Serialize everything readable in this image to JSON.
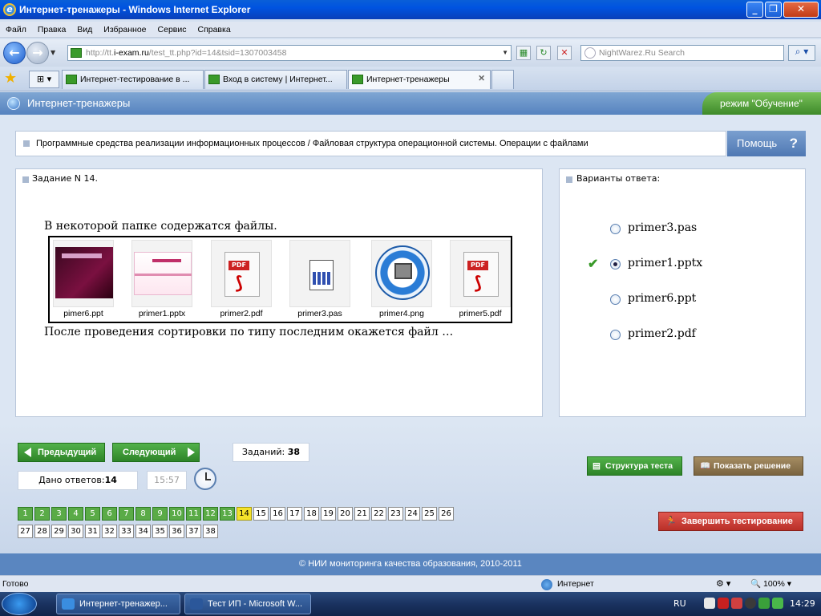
{
  "window": {
    "title": "Интернет-тренажеры - Windows Internet Explorer"
  },
  "menu": [
    "Файл",
    "Правка",
    "Вид",
    "Избранное",
    "Сервис",
    "Справка"
  ],
  "address": {
    "prefix": "http://tt.",
    "domain": "i-exam.ru",
    "path": "/test_tt.php?id=14&tsid=1307003458"
  },
  "search": {
    "placeholder": "NightWarez.Ru Search"
  },
  "tabs": [
    {
      "label": "Интернет-тестирование в ..."
    },
    {
      "label": "Вход в систему | Интернет..."
    },
    {
      "label": "Интернет-тренажеры",
      "active": true
    }
  ],
  "app": {
    "name": "Интернет-тренажеры",
    "mode": "режим \"Обучение\""
  },
  "breadcrumb": "Программные средства реализации информационных процессов / Файловая структура операционной системы. Операции с файлами",
  "help": {
    "label": "Помощь",
    "icon": "?"
  },
  "task": {
    "header": "Задание N 14.",
    "text_before": "В некоторой папке содержатся файлы.",
    "text_after": "После проведения сортировки по типу последним окажется файл …",
    "files": [
      "pimer6.ppt",
      "primer1.pptx",
      "primer2.pdf",
      "primer3.pas",
      "primer4.png",
      "primer5.pdf"
    ]
  },
  "answers": {
    "header": "Варианты ответа:",
    "options": [
      {
        "label": "primer3.pas",
        "selected": false,
        "correct": false
      },
      {
        "label": "primer1.pptx",
        "selected": true,
        "correct": true
      },
      {
        "label": "primer6.ppt",
        "selected": false,
        "correct": false
      },
      {
        "label": "primer2.pdf",
        "selected": false,
        "correct": false
      }
    ]
  },
  "nav": {
    "prev": "Предыдущий",
    "next": "Следующий"
  },
  "stats": {
    "tasks_label": "Заданий:",
    "tasks_count": "38",
    "answered_label": "Дано ответов:",
    "answered_count": "14",
    "timer": "15:57"
  },
  "actions": {
    "structure": "Структура теста",
    "show_solution": "Показать решение",
    "finish": "Завершить тестирование"
  },
  "questions": {
    "total": 38,
    "current": 14,
    "answered_through": 13
  },
  "footer": "© НИИ мониторинга качества образования, 2010-2011",
  "status": {
    "ready": "Готово",
    "zone": "Интернет",
    "zoom": "100%"
  },
  "taskbar": {
    "items": [
      "Интернет-тренажер...",
      "Тест ИП - Microsoft W..."
    ],
    "lang": "RU",
    "time": "14:29"
  },
  "colors": {
    "accent": "#5683bf",
    "done": "#5aab47",
    "current": "#f5e22a",
    "finish": "#d7443f"
  }
}
